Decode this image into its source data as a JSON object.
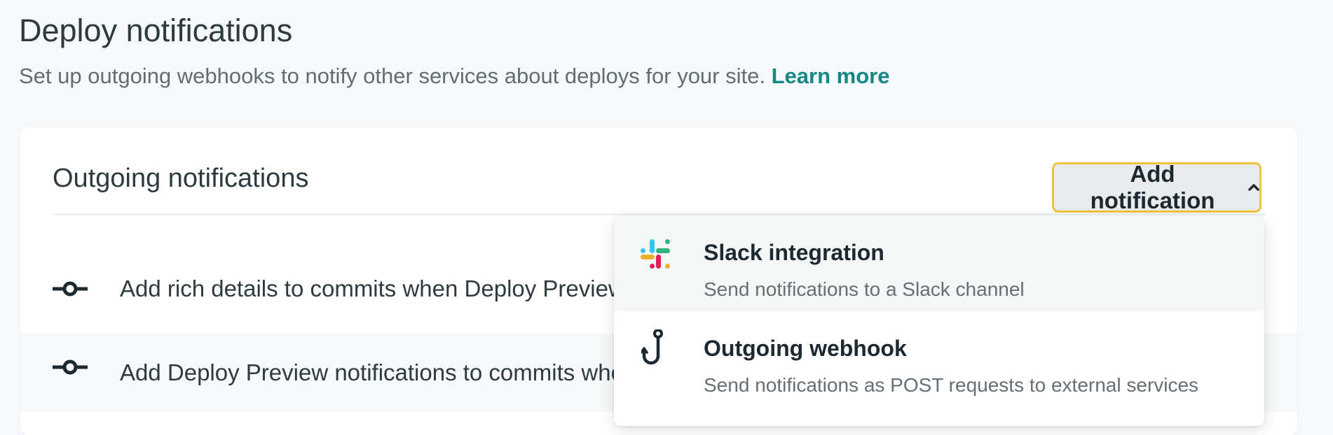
{
  "header": {
    "title": "Deploy notifications",
    "description": "Set up outgoing webhooks to notify other services about deploys for your site.",
    "learn_more": "Learn more"
  },
  "card": {
    "title": "Outgoing notifications",
    "add_button_label": "Add notification",
    "add_button_icon": "chevron-up-icon",
    "rows": [
      {
        "icon": "commit-icon",
        "text": "Add rich details to commits when Deploy Previews"
      },
      {
        "icon": "commit-icon",
        "text": "Add Deploy Preview notifications to commits whe"
      }
    ]
  },
  "dropdown": {
    "items": [
      {
        "icon": "slack-icon",
        "title": "Slack integration",
        "description": "Send notifications to a Slack channel"
      },
      {
        "icon": "webhook-hook-icon",
        "title": "Outgoing webhook",
        "description": "Send notifications as POST requests to external services"
      }
    ]
  },
  "colors": {
    "accent": "#138886",
    "focus_border": "#f0c33c",
    "slack_blue": "#36c5f0",
    "slack_green": "#2eb67d",
    "slack_yellow": "#ecb22e",
    "slack_red": "#e01e5a"
  }
}
